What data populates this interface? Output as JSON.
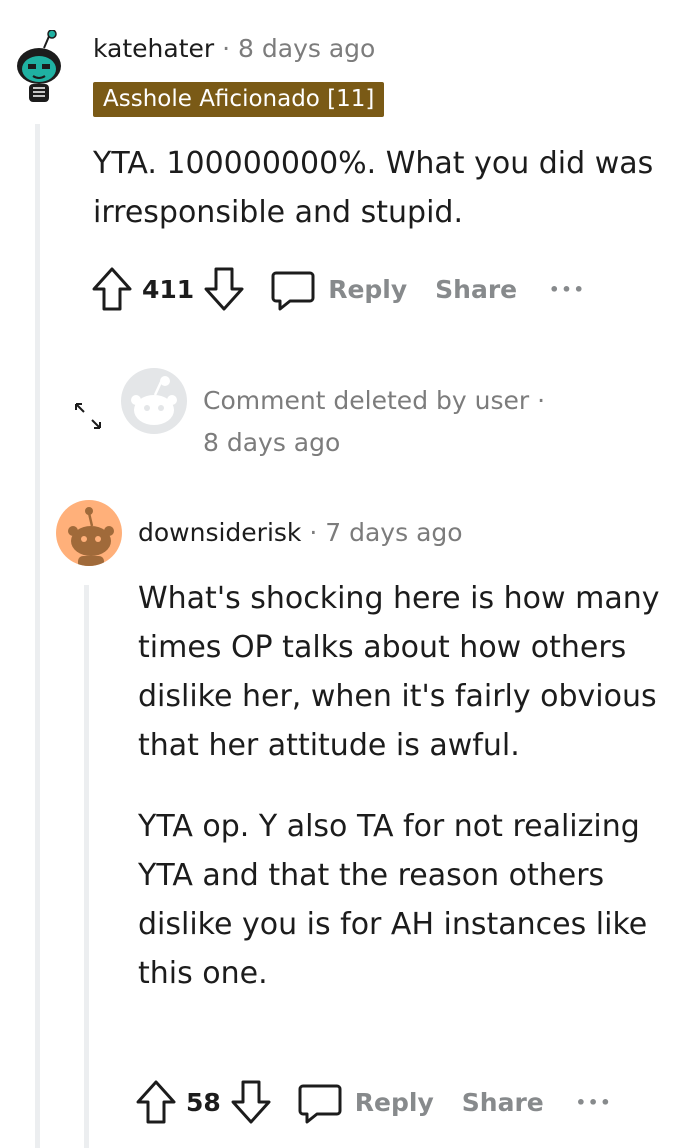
{
  "comment1": {
    "username": "katehater",
    "separator": "·",
    "time": "8 days ago",
    "flair": "Asshole Aficionado [11]",
    "body": "YTA. 100000000%. What you did was irresponsible and stupid.",
    "votes": "411",
    "reply_label": "Reply",
    "share_label": "Share",
    "more_label": "•••"
  },
  "deleted": {
    "text": "Comment deleted by user ·",
    "time": "8 days ago"
  },
  "comment2": {
    "username": "downsiderisk",
    "separator": "·",
    "time": "7 days ago",
    "paragraph1": "What's shocking here is how many times OP talks about how others dislike her, when it's fairly obvious that her attitude is awful.",
    "paragraph2": "YTA op. Y also TA for not realizing YTA and that the reason others dislike you is for AH instances like this one.",
    "votes": "58",
    "reply_label": "Reply",
    "share_label": "Share",
    "more_label": "•••"
  },
  "icons": [
    "upvote-icon",
    "downvote-icon",
    "reply-icon",
    "expand-icon",
    "snoo-avatar",
    "more-icon"
  ],
  "colors": {
    "flair_bg": "#7a5a16",
    "avatar1_bg": "#1fb1a2",
    "avatar2_bg": "#ffb07a",
    "muted": "#878a8c"
  }
}
